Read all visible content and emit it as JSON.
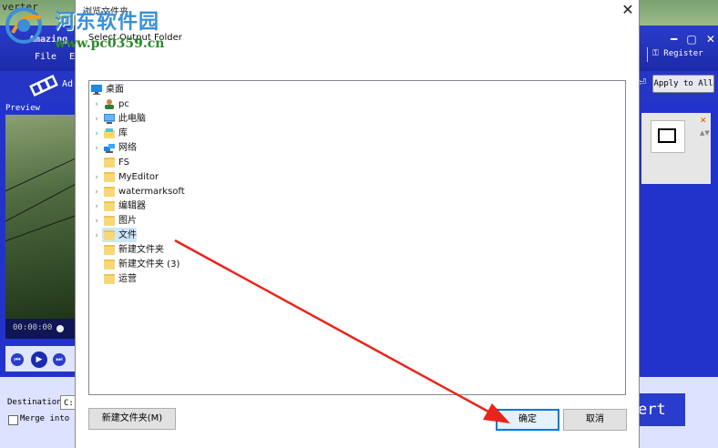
{
  "background_app": {
    "title_fragment": "verter",
    "app_name_fragment": "Amazing",
    "menu": [
      "File",
      "E"
    ],
    "window_controls": "━ ▢ ✕",
    "register_label": "Register",
    "add_label_fragment": "Ad",
    "apply_to_all_label": "Apply to All",
    "preview_label": "Preview",
    "time": "00:00:00",
    "destination_label": "Destination:",
    "destination_value": "C:",
    "merge_label": "Merge into o",
    "convert_label_fragment": "ert",
    "right_close": "✕",
    "right_spin": "▲▼",
    "icons": {
      "prev": "⏮",
      "play": "▶",
      "next": "⏭",
      "apply": "⏎"
    }
  },
  "dialog": {
    "title": "浏览文件夹",
    "close_glyph": "✕",
    "subtitle": "Select Output Folder",
    "tree_items": [
      {
        "label": "桌面",
        "icon": "desktop-icon",
        "expander": "",
        "level": 0
      },
      {
        "label": "pc",
        "icon": "user-icon",
        "expander": "›",
        "level": 1
      },
      {
        "label": "此电脑",
        "icon": "computer-icon",
        "expander": "›",
        "level": 1
      },
      {
        "label": "库",
        "icon": "library-icon",
        "expander": "›",
        "level": 1
      },
      {
        "label": "网络",
        "icon": "network-icon",
        "expander": "›",
        "level": 1
      },
      {
        "label": "FS",
        "icon": "folder-icon",
        "expander": "",
        "level": 1
      },
      {
        "label": "MyEditor",
        "icon": "folder-icon",
        "expander": "›",
        "level": 1
      },
      {
        "label": "watermarksoft",
        "icon": "folder-icon",
        "expander": "›",
        "level": 1
      },
      {
        "label": "编辑器",
        "icon": "folder-icon",
        "expander": "›",
        "level": 1
      },
      {
        "label": "图片",
        "icon": "folder-icon",
        "expander": "›",
        "level": 1
      },
      {
        "label": "文件",
        "icon": "folder-icon",
        "expander": "›",
        "level": 1,
        "selected": true
      },
      {
        "label": "新建文件夹",
        "icon": "folder-icon",
        "expander": "",
        "level": 1
      },
      {
        "label": "新建文件夹 (3)",
        "icon": "folder-icon",
        "expander": "",
        "level": 1
      },
      {
        "label": "运营",
        "icon": "folder-icon",
        "expander": "",
        "level": 1
      }
    ],
    "buttons": {
      "new_folder": "新建文件夹(M)",
      "ok": "确定",
      "cancel": "取消"
    }
  },
  "watermark": {
    "text_line1": "河东软件园",
    "text_line2": "www.pc0359.cn"
  },
  "colors": {
    "app_blue": "#2233cc",
    "selection": "#cce8ff",
    "ok_border": "#0078d7",
    "folder": "#f8d876",
    "annotation_arrow": "#e8251b"
  }
}
